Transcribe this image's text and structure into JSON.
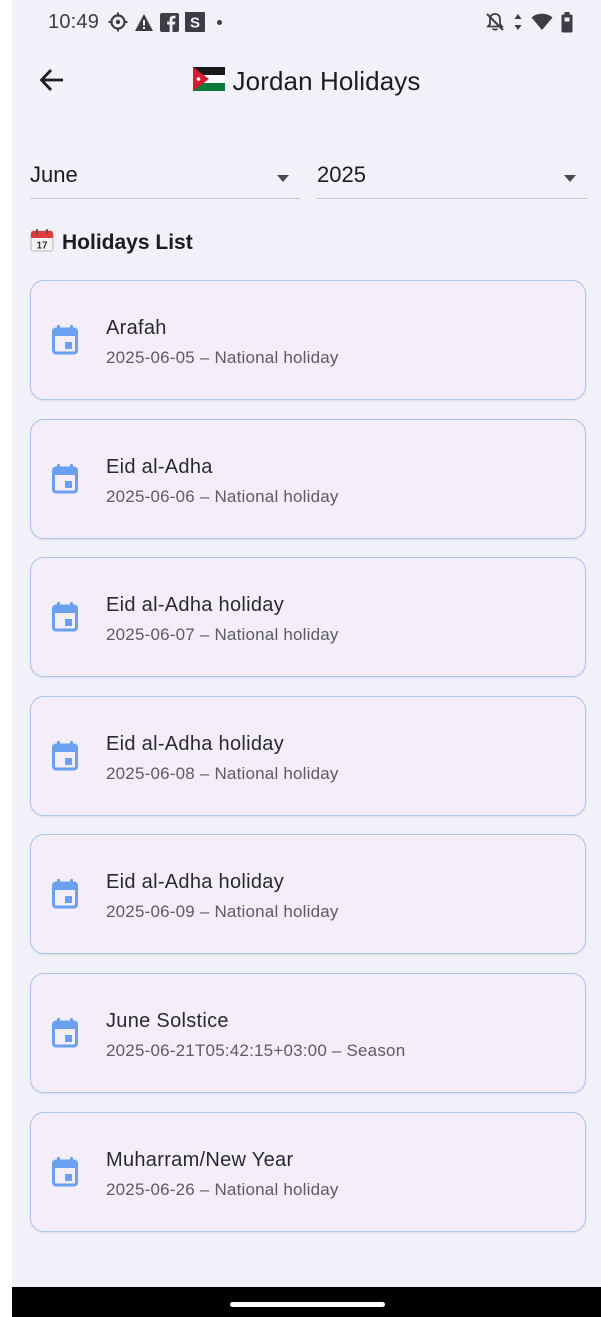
{
  "status_bar": {
    "time": "10:49",
    "left_icons": [
      "settings-icon",
      "warning-icon",
      "facebook-icon",
      "s-app-icon",
      "notification-dot"
    ],
    "right_icons": [
      "mute-icon",
      "data-arrows-icon",
      "wifi-icon",
      "battery-icon"
    ]
  },
  "app_bar": {
    "back_icon": "arrow-left-icon",
    "flag_icon": "jordan-flag",
    "title": "Jordan Holidays"
  },
  "filters": {
    "month": "June",
    "year": "2025"
  },
  "section": {
    "icon": "calendar-emoji-icon",
    "title": "Holidays List"
  },
  "holidays": [
    {
      "name": "Arafah",
      "detail": "2025-06-05 – National holiday"
    },
    {
      "name": "Eid al-Adha",
      "detail": "2025-06-06 – National holiday"
    },
    {
      "name": "Eid al-Adha holiday",
      "detail": "2025-06-07 – National holiday"
    },
    {
      "name": "Eid al-Adha holiday",
      "detail": "2025-06-08 – National holiday"
    },
    {
      "name": "Eid al-Adha holiday",
      "detail": "2025-06-09 – National holiday"
    },
    {
      "name": "June Solstice",
      "detail": "2025-06-21T05:42:15+03:00 – Season"
    },
    {
      "name": "Muharram/New Year",
      "detail": "2025-06-26 – National holiday"
    }
  ],
  "colors": {
    "background": "#f2f1f9",
    "card_background": "#f3eefa",
    "card_border": "#aac4ee",
    "icon_blue": "#6b9ff0",
    "text_primary": "#1d1b20",
    "text_secondary": "#5e5b66"
  }
}
